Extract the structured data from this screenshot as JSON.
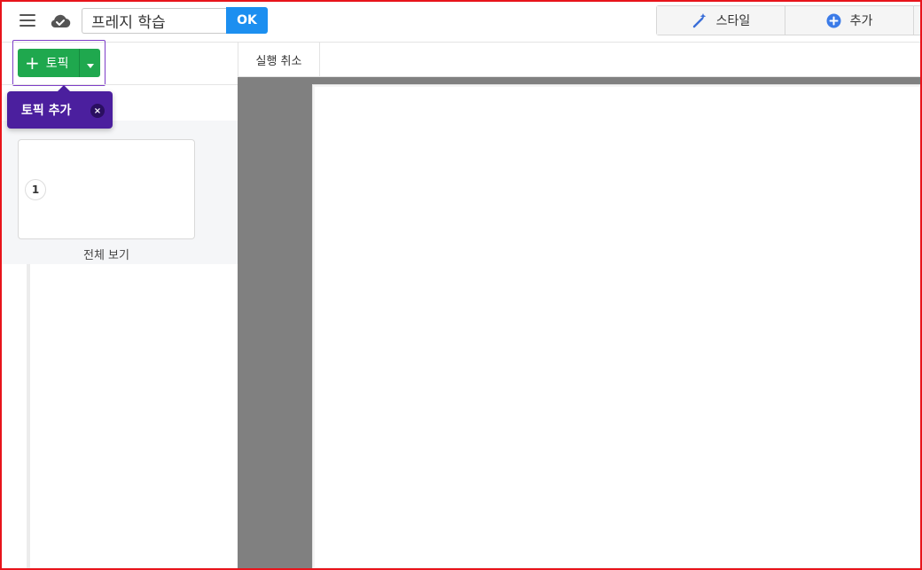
{
  "header": {
    "title_value": "프레지 학습",
    "ok_label": "OK",
    "style_label": "스타일",
    "add_label": "추가"
  },
  "sidebar": {
    "topic_button_label": "토픽",
    "tooltip_text": "토픽 추가",
    "tooltip_close": "×",
    "thumbnail_number": "1",
    "thumbnail_label": "전체 보기"
  },
  "canvas": {
    "undo_label": "실행 취소"
  },
  "colors": {
    "topic_green": "#1fa84e",
    "ok_blue": "#1c8ff0",
    "tooltip_purple": "#4b1f9e",
    "frame_red": "#e8141b"
  },
  "icons": {
    "menu": "hamburger-menu-icon",
    "cloud": "cloud-saved-icon",
    "style": "magic-wand-icon",
    "add": "plus-circle-icon",
    "dropdown": "caret-down-icon"
  }
}
